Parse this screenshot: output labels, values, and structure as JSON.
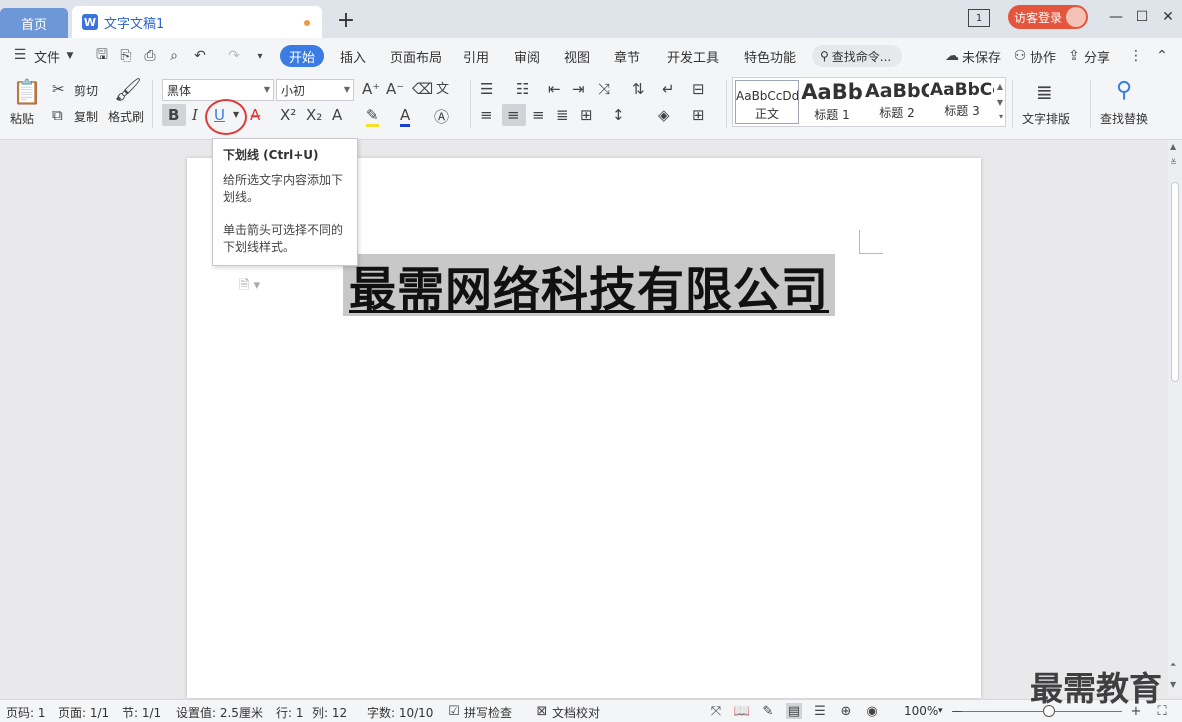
{
  "tabs": {
    "home": "首页",
    "doc": "文字文稿1",
    "new": "+"
  },
  "window": {
    "login": "访客登录",
    "view_badge": "1",
    "minimize": "—",
    "maximize": "☐",
    "close": "✕"
  },
  "menu": {
    "file": "文件",
    "items": [
      "开始",
      "插入",
      "页面布局",
      "引用",
      "审阅",
      "视图",
      "章节",
      "开发工具",
      "特色功能"
    ],
    "search": "查找命令...",
    "unsaved": "未保存",
    "collab": "协作",
    "share": "分享"
  },
  "ribbon": {
    "paste": "粘贴",
    "cut": "剪切",
    "copy": "复制",
    "format_painter": "格式刷",
    "font_name": "黑体",
    "font_size": "小初",
    "bold": "B",
    "italic": "I",
    "underline": "U",
    "text_layout": "文字排版",
    "find_replace": "查找替换",
    "styles": [
      {
        "sample": "AaBbCcDd",
        "name": "正文"
      },
      {
        "sample": "AaBb",
        "name": "标题 1"
      },
      {
        "sample": "AaBbC",
        "name": "标题 2"
      },
      {
        "sample": "AaBbCc",
        "name": "标题 3"
      }
    ]
  },
  "tooltip": {
    "title": "下划线 (Ctrl+U)",
    "line1": "给所选文字内容添加下划线。",
    "line2": "单击箭头可选择不同的下划线样式。"
  },
  "document": {
    "heading": "最需网络科技有限公司"
  },
  "status": {
    "page": "页码: 1",
    "pages": "页面: 1/1",
    "section": "节: 1/1",
    "setting": "设置值: 2.5厘米",
    "row": "行: 1",
    "col": "列: 12",
    "words": "字数: 10/10",
    "spell": "拼写检查",
    "proof": "文档校对",
    "zoom": "100%",
    "zoom_minus": "—",
    "zoom_plus": "+"
  },
  "watermark": "最需教育",
  "colors": {
    "accent": "#3a7be4",
    "login": "#e5553e",
    "highlight": "#c8c8c8",
    "circle": "#e03b3b"
  }
}
